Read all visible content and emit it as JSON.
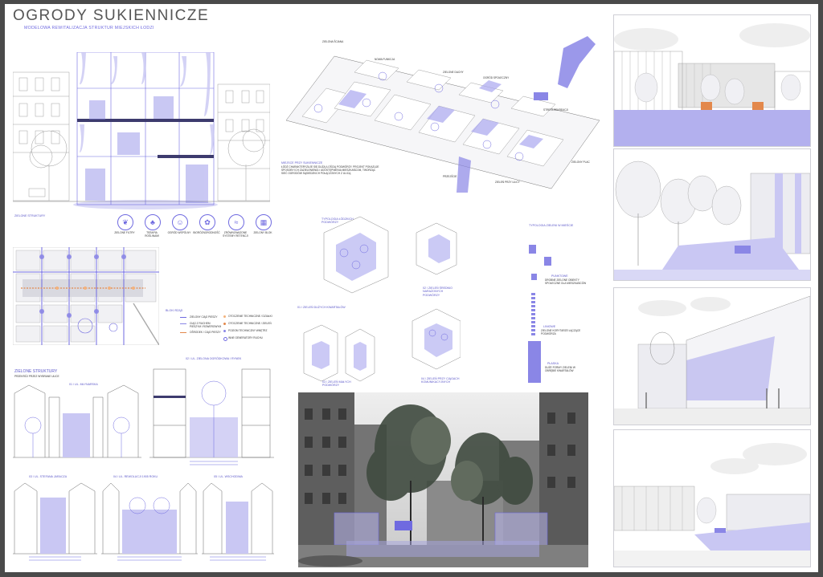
{
  "title": "OGRODY SUKIENNICZE",
  "subtitle": "MODELOWA REWITALIZACJA STRUKTUR MIEJSKICH ŁODZI",
  "colors": {
    "accent": "#6f6ae0",
    "accent_light": "#c9c7f3",
    "ink": "#444444",
    "frame": "#4a4a4a"
  },
  "section_strip": {
    "label": "ZIELONE STRUKTURY",
    "icons": [
      {
        "label": "ZIELONE FILTRY",
        "icon": "leaf-icon"
      },
      {
        "label": "TERAPIA ROŚLINAMI",
        "icon": "plant-icon"
      },
      {
        "label": "OGRÓD WSPÓLNY",
        "icon": "people-icon"
      },
      {
        "label": "BIORÓŻNORODNOŚĆ",
        "icon": "flower-icon"
      },
      {
        "label": "ZRÓWNOWAŻONE SYSTEMY RETENCJI",
        "icon": "water-icon"
      },
      {
        "label": "ZIELONY BLOK",
        "icon": "building-icon"
      }
    ]
  },
  "map": {
    "legend_title": "BLOKI RZĄD",
    "legend_left": [
      "zielony ciąg pieszy",
      "ciąg z ruchem pieszym i rowerowym",
      "ośrodek / ciąg pieszy"
    ],
    "legend_right": [
      "otoczenie techniczne / działki",
      "otoczenie techniczne / zieleń",
      "poziom techniczny wnętrz",
      "inne generatory ruchu"
    ]
  },
  "isometric": {
    "note_title": "MIEJSCE PRZY SUKIENNICZE",
    "note_text": "ŁÓDŹ CHARAKTERYZUJE SIĘ DUŻĄ ILOŚCIĄ PODWÓRZY. PROJEKT POKAZUJE SPOSOBY ICH ZAZIELENIENIA I UDOSTĘPNIENIA MIESZKAŃCOM, TWORZĄC SIEĆ OGRODÓW SĄSIEDZKICH POŁĄCZONYCH Z ULICĄ.",
    "callouts": [
      "ZIELONA ŚCIANA",
      "NOWA FUNKCJA",
      "ZIELONE DACHY",
      "OGRÓD SPOŁECZNY",
      "STREFA REKREACJI",
      "ZIELONY PLAC",
      "PRZEJŚCIE",
      "ZIELEŃ PRZY ULICY"
    ]
  },
  "typology_courtyard": {
    "title": "TYPOLOGIA ŁÓDZKICH PODWÓRZY",
    "labels": [
      "01 / ZIELEŃ DUŻYCH KWARTAŁÓW",
      "02 / ZIELEŃ ŚREDNIO NARAŻONYCH PODWÓRZY",
      "03 / ZIELEŃ MAŁYCH PODWÓRZY",
      "04 / ZIELEŃ PRZY CIĄGACH KOMUNIKACYJNYCH"
    ]
  },
  "typology_green": {
    "title": "TYPOLOGIA ZIELENI W MIEŚCIE",
    "items": [
      {
        "name": "PUNKTOWE",
        "desc": "DROBNE ZIELONE OBIEKTY SPOŁECZNE DLA MIESZKAŃCÓW"
      },
      {
        "name": "LINIOWE",
        "desc": "ZIELONE KORYTARZE ŁĄCZĄCE PODWÓRZA"
      },
      {
        "name": "PŁASKA",
        "desc": "DUŻE FORMY ZIELENI W OBRĘBIE KWARTAŁÓW"
      }
    ]
  },
  "sections_block": {
    "title": "ZIELONE STRUKTURY",
    "subtitle": "PRZEKRÓJ PRZEZ WYBRANE ULICE",
    "labels": [
      "01 / UL. MŁYNARSKA",
      "02 / UL. ZIELONA OGRÓDKOWA / RYNEK",
      "03 / UL. STEFANA JARACZA",
      "04 / UL. REWOLUCJI 1905 ROKU",
      "05 / UL. WSCHODNIA"
    ]
  }
}
